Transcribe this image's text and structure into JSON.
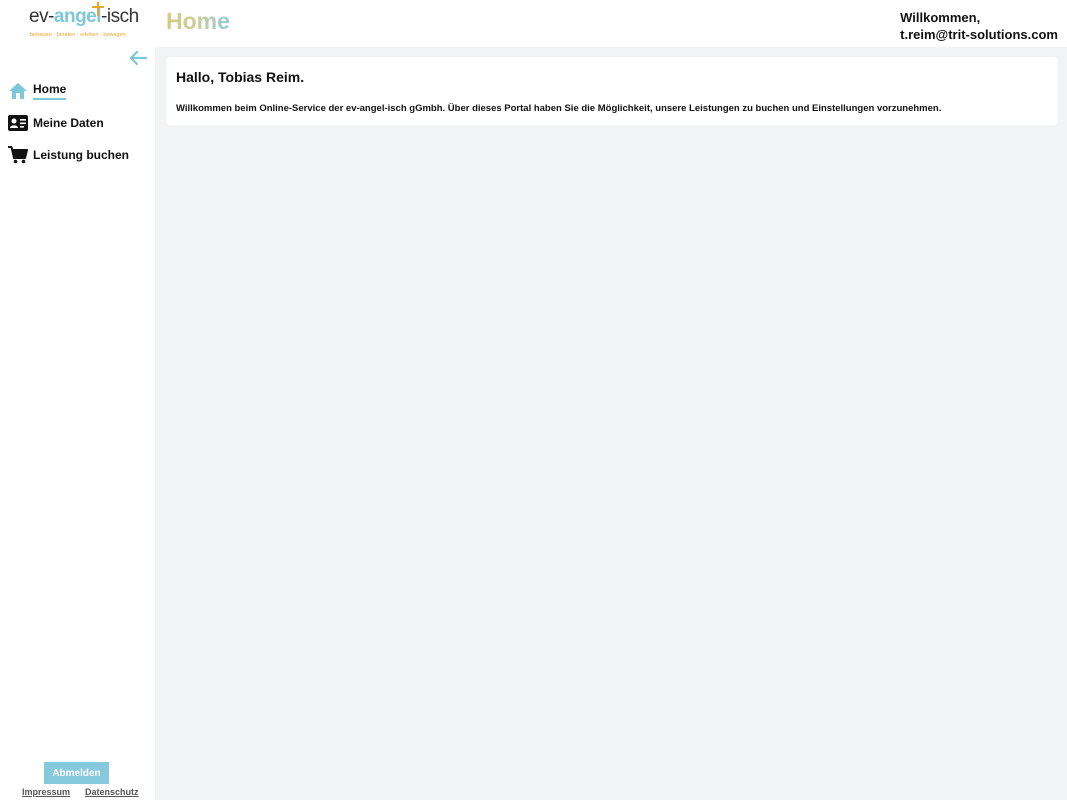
{
  "header": {
    "logo": {
      "prefix": "ev-",
      "accent": "angel",
      "suffix": "-isch",
      "tagline": "betreuen · beraten · erleben · bewegen"
    },
    "page_title": "Home",
    "welcome_line1": "Willkommen,",
    "welcome_line2": "t.reim@trit-solutions.com"
  },
  "sidebar": {
    "collapse_icon": "arrow-left-icon",
    "items": [
      {
        "label": "Home",
        "icon": "home-icon",
        "active": true
      },
      {
        "label": "Meine Daten",
        "icon": "id-card-icon",
        "active": false
      },
      {
        "label": "Leistung buchen",
        "icon": "cart-icon",
        "active": false
      }
    ],
    "logout_label": "Abmelden",
    "footer_links": [
      "Impressum",
      "Datenschutz"
    ]
  },
  "main": {
    "greeting": "Hallo, Tobias Reim.",
    "intro": "Willkommen beim Online-Service der ev-angel-isch gGmbh. Über dieses Portal haben Sie die Möglichkeit, unsere Leistungen zu buchen und Einstellungen vorzunehmen."
  },
  "colors": {
    "accent": "#7cc7d9",
    "logo_gold": "#e7a72e",
    "background": "#f2f3f5",
    "button": "#86c9dc"
  }
}
